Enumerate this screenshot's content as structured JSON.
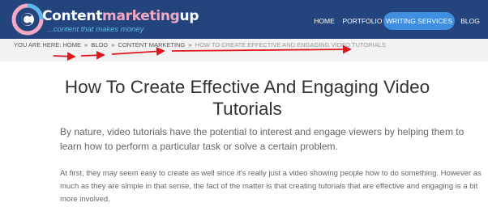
{
  "brand": {
    "name_part1": "Content",
    "name_part2": "marketing",
    "name_part3": "up",
    "tagline": "...content that makes money",
    "colors": {
      "header_bg": "#23447c",
      "accent_pink": "#f3a9c4",
      "accent_blue": "#5db7e8",
      "button_bg": "#3f8ee0"
    }
  },
  "nav": {
    "items": [
      {
        "label": "HOME"
      },
      {
        "label": "PORTFOLIO"
      },
      {
        "label": "WRITING SERVICES",
        "active": true
      },
      {
        "label": "BLOG"
      }
    ]
  },
  "breadcrumb": {
    "prefix": "YOU ARE HERE:",
    "items": [
      "HOME",
      "BLOG",
      "CONTENT MARKETING"
    ],
    "separator": "»",
    "current": "HOW TO CREATE EFFECTIVE AND ENGAGING VIDEO TUTORIALS",
    "annotation_color": "#e0161e"
  },
  "article": {
    "title": "How To Create Effective And Engaging Video Tutorials",
    "lead": "By nature, video tutorials have the potential to interest and engage viewers by helping them to learn how to perform a particular task or solve a certain problem.",
    "paragraph": "At first, they may seem easy to create as well since it's really just a video showing people how to do something. However as much as they are simple in that sense, the fact of the matter is that creating tutorials that are effective and engaging is a bit more involved."
  }
}
